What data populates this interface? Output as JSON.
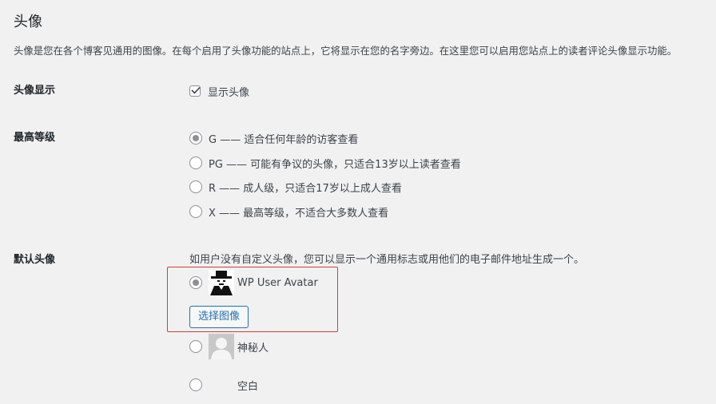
{
  "section": {
    "title": "头像",
    "description": "头像是您在各个博客见通用的图像。在每个启用了头像功能的站点上，它将显示在您的名字旁边。在这里您可以启用您站点上的读者评论头像显示功能。"
  },
  "show_avatars": {
    "label": "头像显示",
    "checkbox_label": "显示头像",
    "checked": true
  },
  "max_rating": {
    "label": "最高等级",
    "options": [
      {
        "label": "G —— 适合任何年龄的访客查看",
        "checked": true
      },
      {
        "label": "PG —— 可能有争议的头像，只适合13岁以上读者查看",
        "checked": false
      },
      {
        "label": "R —— 成人级，只适合17岁以上成人查看",
        "checked": false
      },
      {
        "label": "X —— 最高等级，不适合大多数人查看",
        "checked": false
      }
    ]
  },
  "default_avatar": {
    "label": "默认头像",
    "note": "如用户没有自定义头像，您可以显示一个通用标志或用他们的电子邮件地址生成一个。",
    "options": [
      {
        "label": "WP User Avatar",
        "checked": true,
        "icon": "spy-avatar-icon"
      },
      {
        "label": "神秘人",
        "checked": false,
        "icon": "mystery-person-icon"
      },
      {
        "label": "空白",
        "checked": false,
        "icon": "blank-avatar"
      }
    ],
    "choose_image_button": "选择图像"
  },
  "colors": {
    "background": "#f1f1f1",
    "text": "#3c434a",
    "heading": "#1d2327",
    "button": "#2271b1",
    "highlight_border": "#d33b3b"
  }
}
